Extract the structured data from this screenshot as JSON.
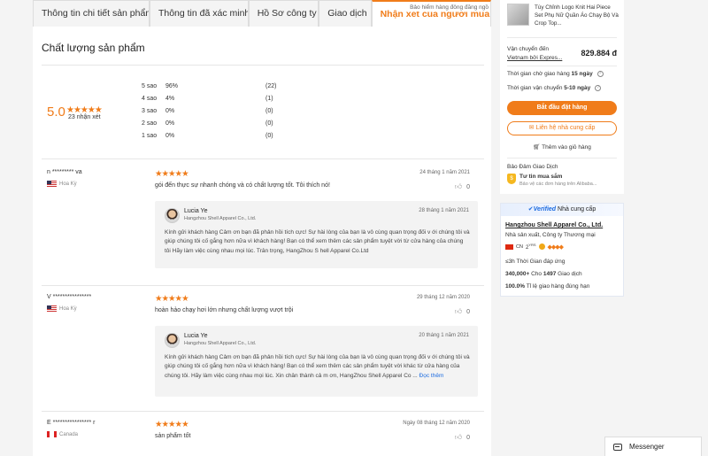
{
  "tabs": [
    {
      "label": "Thông tin chi tiết sản phẩm"
    },
    {
      "label": "Thông tin đã xác minh"
    },
    {
      "label": "Hồ Sơ công ty"
    },
    {
      "label": "Giao dịch"
    },
    {
      "label": "Nhận xét của người mua",
      "tip": "Bảo hiểm hàng đông đăng ngồ"
    }
  ],
  "quality": {
    "title": "Chất lượng sản phẩm",
    "score": "5.0",
    "stars": "★★★★★",
    "review_count": "23 nhận xét",
    "distribution": [
      {
        "label": "5 sao",
        "percent": "96%",
        "count": "(22)"
      },
      {
        "label": "4 sao",
        "percent": "4%",
        "count": "(1)"
      },
      {
        "label": "3 sao",
        "percent": "0%",
        "count": "(0)"
      },
      {
        "label": "2 sao",
        "percent": "0%",
        "count": "(0)"
      },
      {
        "label": "1 sao",
        "percent": "0%",
        "count": "(0)"
      }
    ]
  },
  "reviews": [
    {
      "reviewer": "n ********* va",
      "country": "Hoa Kỳ",
      "stars": "★★★★★",
      "date": "24 tháng 1 năm 2021",
      "text": "gói đến thực sự nhanh chóng và có chất lượng tốt. Tôi thích nó!",
      "likes": "0",
      "reply": {
        "name": "Lucia Ye",
        "company": "Hangzhou Shell Apparel Co., Ltd.",
        "date": "28 tháng 1 năm 2021",
        "body": "Kính gửi khách hàng Cảm ơn bạn đã phản hồi tích cực! Sự hài lòng của bạn là vô cùng quan trọng đối v ới chúng tôi và giúp chúng tôi cố gắng hơn nữa vì khách hàng! Bạn có thể xem thêm các sản phẩm tuyệt vời từ cửa hàng của chúng tôi Hãy làm việc cùng nhau mọi lúc. Trân trọng, HangZhou S hell Apparel Co.Ltd",
        "more": ""
      }
    },
    {
      "reviewer": "V ****************",
      "country": "Hoa Kỳ",
      "stars": "★★★★★",
      "date": "29 tháng 12 năm 2020",
      "text": "hoàn hảo chạy hơi lớn nhưng chất lượng vượt trội",
      "likes": "0",
      "reply": {
        "name": "Lucia Ye",
        "company": "Hangzhou Shell Apparel Co., Ltd.",
        "date": "20 tháng 1 năm 2021",
        "body": "Kính gửi khách hàng Cảm ơn bạn đã phản hồi tích cực! Sự hài lòng của bạn là vô cùng quan trọng đối v ới chúng tôi và giúp chúng tôi cố gắng hơn nữa vì khách hàng! Bạn có thể xem thêm các sản phẩm tuyệt vời khác từ cửa hàng của chúng tôi. Hãy làm việc cùng nhau mọi lúc. Xin chân thành cả m ơn, HangZhou Shell Apparel Co ...",
        "more": "Đọc thêm"
      }
    },
    {
      "reviewer": "E **************** r",
      "country": "Canada",
      "stars": "★★★★★",
      "date": "Ngày 08 tháng 12 năm 2020",
      "text": "sản phẩm tốt",
      "likes": "0"
    }
  ],
  "sidebar": {
    "product_name": "Tùy Chỉnh Logo Knit Hai Piece Set Phụ Nữ Quần Áo Chạy Bộ Và Crop Top...",
    "shipping_label": "Vận chuyển đến",
    "shipping_link": "Vietnam bởi Expres...",
    "shipping_price": "829.884 đ",
    "wait_label": "Thời gian chờ giao hàng",
    "wait_value": "15 ngày",
    "ship_time_label": "Thời gian vận chuyển",
    "ship_time_value": "5-10 ngày",
    "order_button": "Bắt đầu đặt hàng",
    "contact_button": "Liên hệ nhà cung cấp",
    "cart_label": "Thêm vào giỏ hàng",
    "guarantee_title": "Bảo Đảm Giao Dịch",
    "guarantee_name": "Tư tin mua sắm",
    "guarantee_desc": "Bảo vệ các đơn hàng trên Alibaba...",
    "verified_label": "Verified",
    "verified_suffix": "Nhà cung cấp",
    "supplier_name": "Hangzhou Shell Apparel Co., Ltd.",
    "supplier_type": "Nhà sản xuất, Công ty Thương mại",
    "country_code": "CN",
    "years": "2",
    "years_unit": "YRS",
    "response_value": "≤3h",
    "response_label": "Thời Gian đáp ứng",
    "transactions_value": "340,000+",
    "transactions_mid": "Cho",
    "transactions_count": "1497",
    "transactions_label": "Giao dịch",
    "ontime_value": "100.0%",
    "ontime_label": "Tỉ lệ giao hàng đúng hạn"
  },
  "messenger": {
    "label": "Messenger"
  },
  "colors": {
    "accent": "#f07c1a",
    "link": "#1d6ce0"
  }
}
